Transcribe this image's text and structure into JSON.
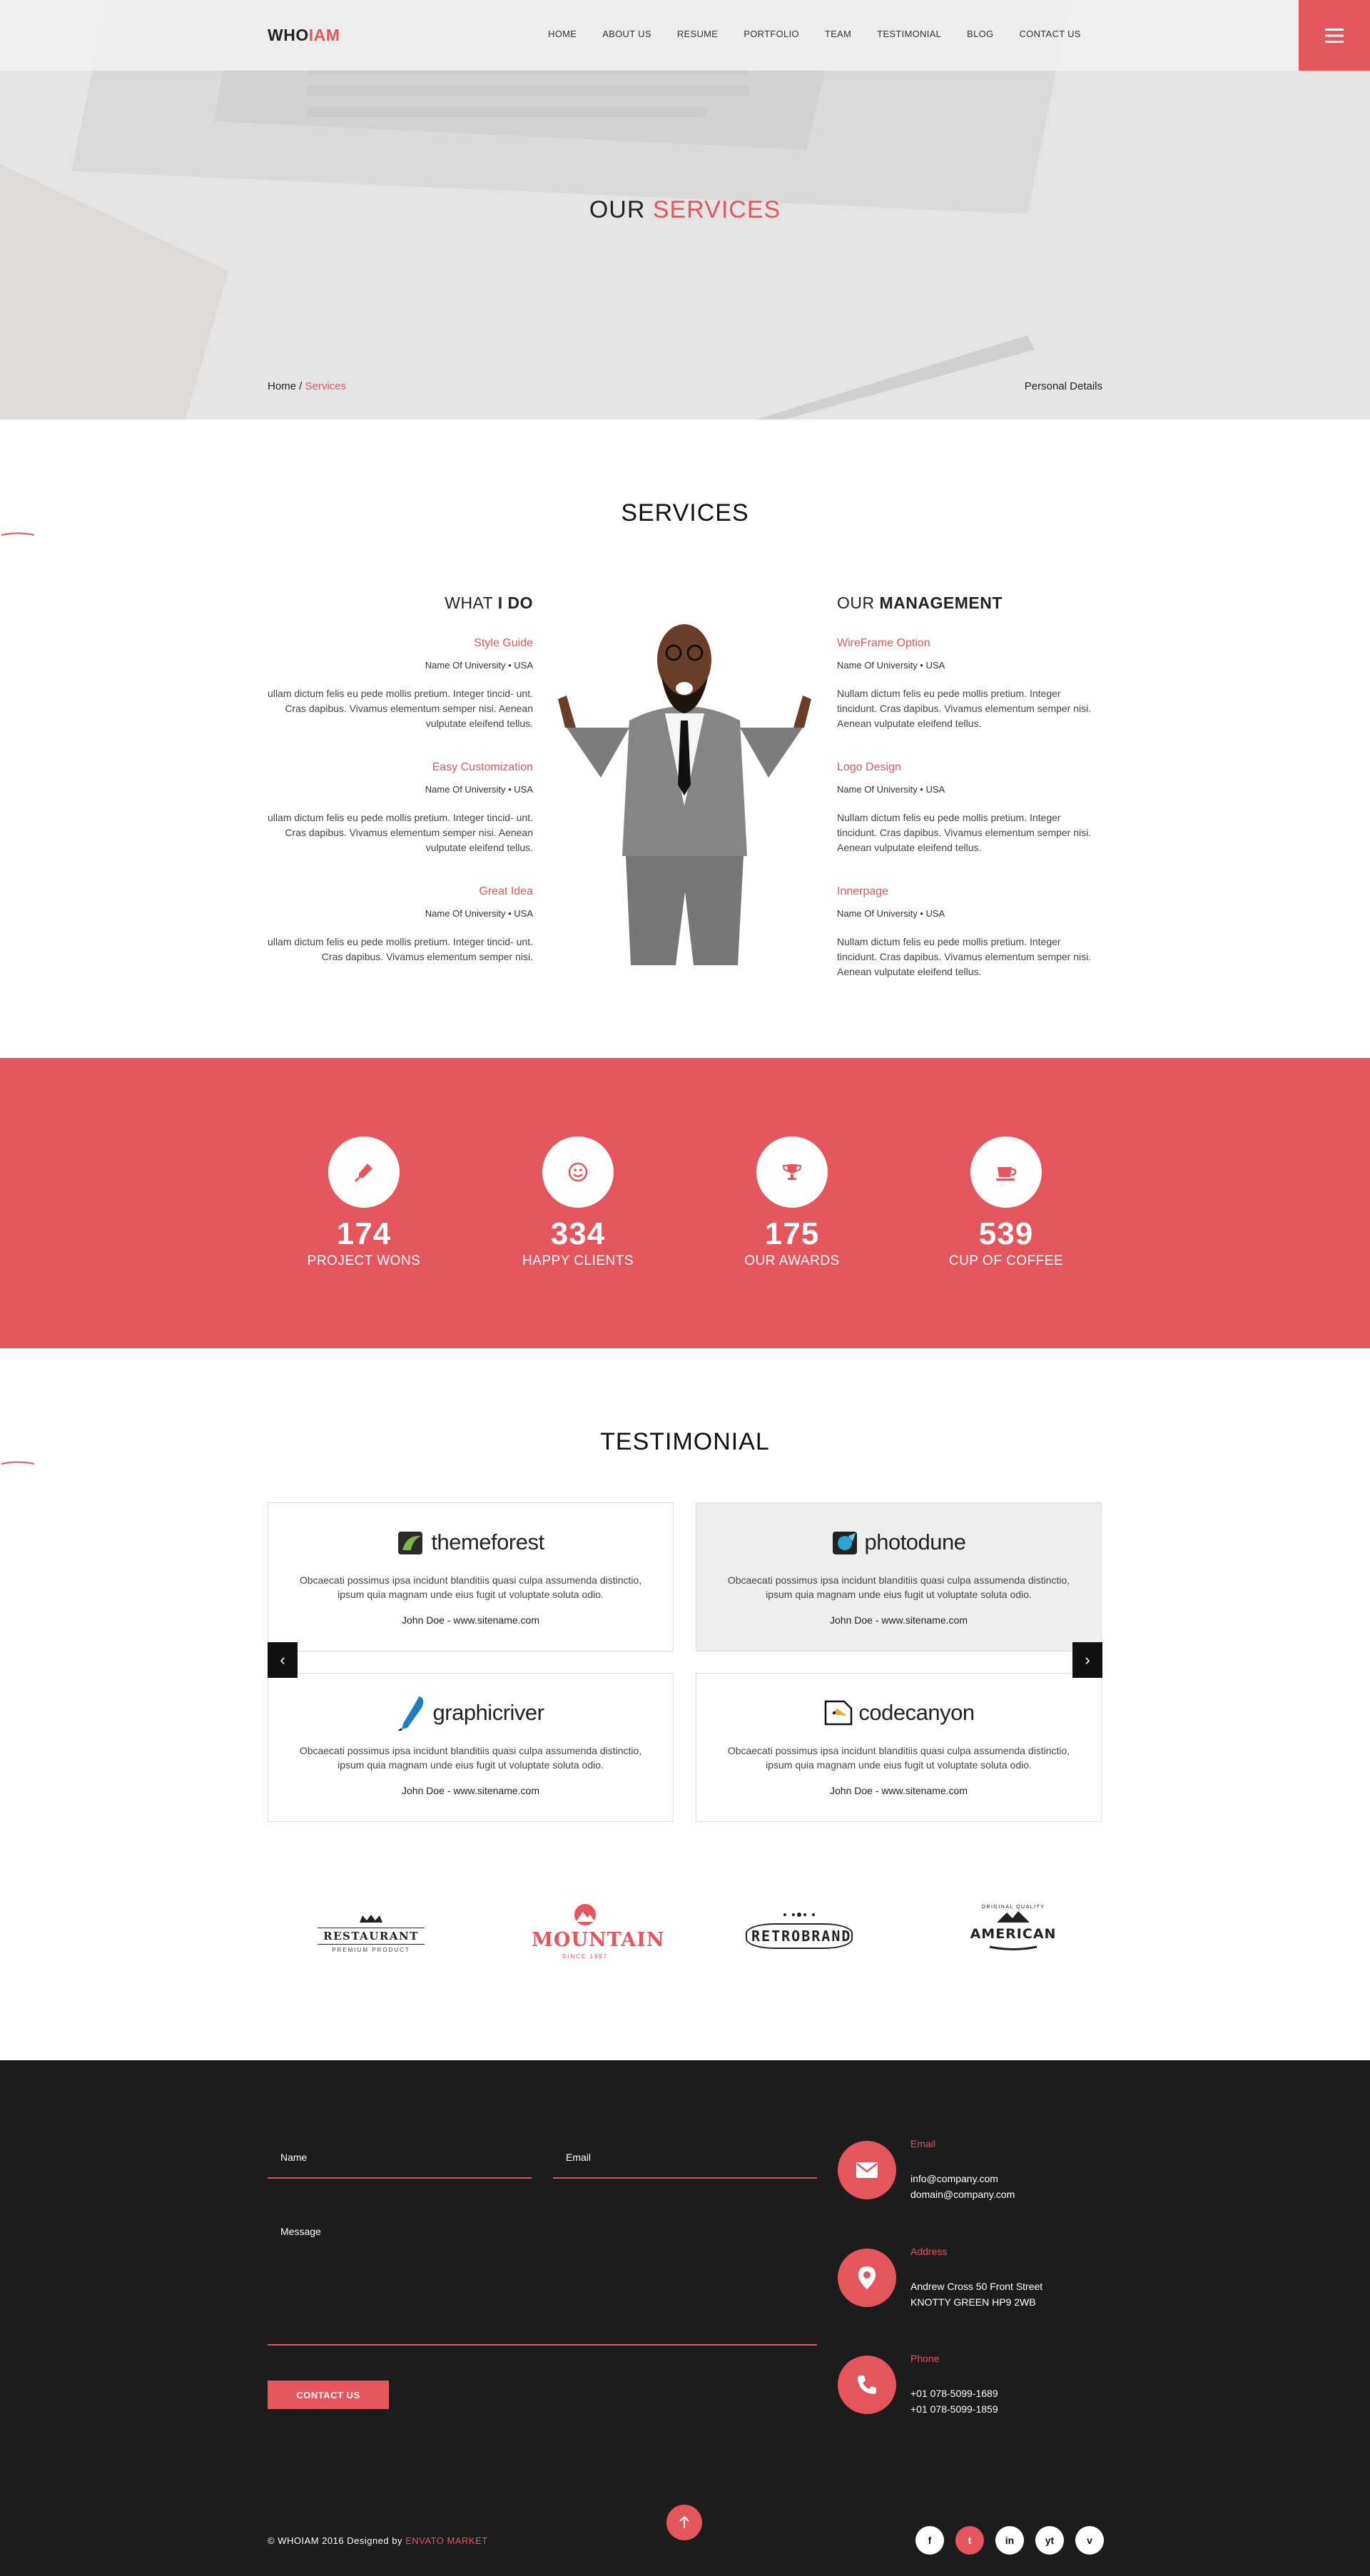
{
  "header": {
    "logo_part1": "WHO",
    "logo_part2": "IAM",
    "nav": [
      "HOME",
      "ABOUT US",
      "RESUME",
      "PORTFOLIO",
      "TEAM",
      "TESTIMONIAL",
      "BLOG",
      "CONTACT US"
    ],
    "menu_icon": "hamburger-icon"
  },
  "hero": {
    "title_part1": "OUR",
    "title_part2": "SERVICES",
    "breadcrumb_home": "Home",
    "breadcrumb_sep": " / ",
    "breadcrumb_current": "Services",
    "right_label": "Personal Details"
  },
  "services": {
    "title": "SERVICES",
    "left_heading_part1": "WHAT",
    "left_heading_part2": "I DO",
    "right_heading_part1": "OUR",
    "right_heading_part2": "MANAGEMENT",
    "left": [
      {
        "title": "Style Guide",
        "sub": "Name Of University • USA",
        "desc": "ullam dictum felis eu pede mollis pretium. Integer tincid- unt. Cras dapibus. Vivamus elementum semper nisi. Aenean vulputate eleifend tellus."
      },
      {
        "title": "Easy Customization",
        "sub": "Name Of University • USA",
        "desc": "ullam dictum felis eu pede mollis pretium. Integer tincid- unt. Cras dapibus. Vivamus elementum semper nisi. Aenean vulputate eleifend tellus."
      },
      {
        "title": "Great Idea",
        "sub": "Name Of University • USA",
        "desc": "ullam dictum felis eu pede mollis pretium. Integer tincid- unt. Cras dapibus. Vivamus elementum semper nisi."
      }
    ],
    "right": [
      {
        "title": "WireFrame Option",
        "sub": "Name Of University • USA",
        "desc": "Nullam dictum felis eu pede mollis pretium. Integer tincidunt. Cras dapibus. Vivamus elementum semper nisi. Aenean vulputate eleifend tellus."
      },
      {
        "title": "Logo Design",
        "sub": "Name Of University • USA",
        "desc": "Nullam dictum felis eu pede mollis pretium. Integer tincidunt. Cras dapibus. Vivamus elementum semper nisi. Aenean vulputate eleifend tellus."
      },
      {
        "title": "Innerpage",
        "sub": "Name Of University • USA",
        "desc": "Nullam dictum felis eu pede mollis pretium. Integer tincidunt. Cras dapibus. Vivamus elementum semper nisi. Aenean vulputate eleifend tellus."
      }
    ]
  },
  "stats": [
    {
      "icon": "pen-nib-icon",
      "value": "174",
      "label": "PROJECT WONS"
    },
    {
      "icon": "smile-icon",
      "value": "334",
      "label": "HAPPY CLIENTS"
    },
    {
      "icon": "trophy-icon",
      "value": "175",
      "label": "OUR AWARDS"
    },
    {
      "icon": "coffee-cup-icon",
      "value": "539",
      "label": "CUP OF COFFEE"
    }
  ],
  "testimonial": {
    "title": "TESTIMONIAL",
    "cards": [
      {
        "brand": "themeforest",
        "quote": "Obcaecati possimus ipsa incidunt blanditiis quasi culpa assumenda distinctio, ipsum quia magnam unde eius fugit ut voluptate soluta odio.",
        "by": "John Doe - www.sitename.com"
      },
      {
        "brand": "photodune",
        "quote": "Obcaecati possimus ipsa incidunt blanditiis quasi culpa assumenda distinctio, ipsum quia magnam unde eius fugit ut voluptate soluta odio.",
        "by": "John Doe - www.sitename.com"
      },
      {
        "brand": "graphicriver",
        "quote": "Obcaecati possimus ipsa incidunt blanditiis quasi culpa assumenda distinctio, ipsum quia magnam unde eius fugit ut voluptate soluta odio.",
        "by": "John Doe - www.sitename.com"
      },
      {
        "brand": "codecanyon",
        "quote": "Obcaecati possimus ipsa incidunt blanditiis quasi culpa assumenda distinctio, ipsum quia magnam unde eius fugit ut voluptate soluta odio.",
        "by": "John Doe - www.sitename.com"
      }
    ],
    "prev_icon": "chevron-left-icon",
    "next_icon": "chevron-right-icon"
  },
  "clients": [
    {
      "name": "RESTAURANT",
      "sub": "PREMIUM PRODUCT"
    },
    {
      "name": "MOUNTAIN",
      "sub": "SINCE 1997"
    },
    {
      "name": "RETROBRAND",
      "sub": ""
    },
    {
      "name": "AMERICAN",
      "sub": "ORIGINAL QUALITY"
    }
  ],
  "contact": {
    "name_label": "Name",
    "email_label": "Email",
    "message_label": "Message",
    "button": "CONTACT US",
    "email_title": "Email",
    "email_lines": [
      "info@company.com",
      "domain@company.com"
    ],
    "address_title": "Address",
    "address_lines": [
      "Andrew Cross 50 Front Street",
      "KNOTTY GREEN HP9 2WB"
    ],
    "phone_title": "Phone",
    "phone_lines": [
      "+01 078-5099-1689",
      "+01 078-5099-1859"
    ]
  },
  "footer": {
    "copy_text": "© WHOIAM 2016 Designed by ",
    "copy_link": "ENVATO MARKET",
    "socials": [
      "f",
      "t",
      "in",
      "yt",
      "v"
    ]
  },
  "colors": {
    "accent": "#e5555c",
    "dark": "#1c1c1c"
  }
}
